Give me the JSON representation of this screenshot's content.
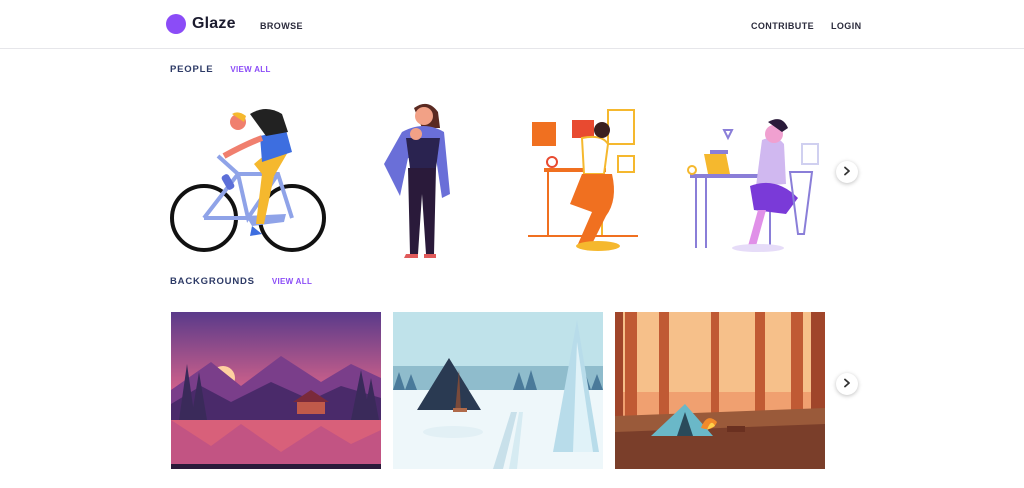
{
  "header": {
    "brand": "Glaze",
    "nav_browse": "BROWSE",
    "nav_contribute": "CONTRIBUTE",
    "nav_login": "LOGIN"
  },
  "sections": {
    "people": {
      "title": "PEOPLE",
      "view_all": "VIEW ALL"
    },
    "backgrounds": {
      "title": "BACKGROUNDS",
      "view_all": "VIEW ALL"
    }
  },
  "colors": {
    "accent": "#8b4cf7",
    "section_title": "#2d3a66"
  },
  "icons": {
    "next_people": "chevron-right-icon",
    "next_backgrounds": "chevron-right-icon"
  }
}
